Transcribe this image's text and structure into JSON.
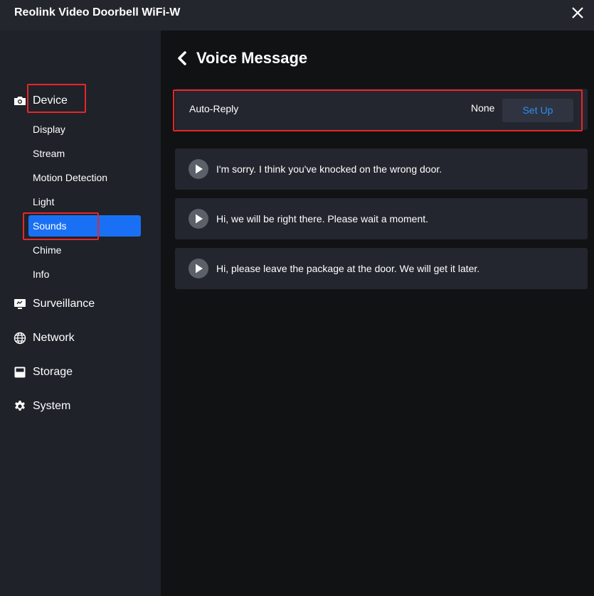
{
  "window": {
    "title": "Reolink Video Doorbell WiFi-W",
    "close_icon": "close-icon"
  },
  "sidebar": {
    "categories": [
      {
        "label": "Device",
        "icon": "camera-icon"
      },
      {
        "label": "Surveillance",
        "icon": "monitor-icon"
      },
      {
        "label": "Network",
        "icon": "globe-icon"
      },
      {
        "label": "Storage",
        "icon": "storage-icon"
      },
      {
        "label": "System",
        "icon": "gear-icon"
      }
    ],
    "device_items": [
      {
        "label": "Display"
      },
      {
        "label": "Stream"
      },
      {
        "label": "Motion Detection"
      },
      {
        "label": "Light"
      },
      {
        "label": "Sounds",
        "active": true
      },
      {
        "label": "Chime"
      },
      {
        "label": "Info"
      }
    ]
  },
  "main": {
    "title": "Voice Message",
    "auto_reply": {
      "label": "Auto-Reply",
      "value": "None",
      "button_label": "Set Up"
    },
    "messages": [
      {
        "text": "I'm sorry. I think you've knocked on the wrong door."
      },
      {
        "text": "Hi, we will be right there. Please wait a moment."
      },
      {
        "text": "Hi, please leave the package at the door. We will get it later."
      }
    ]
  },
  "colors": {
    "accent": "#1a70f4",
    "annotation": "#e8262a",
    "link": "#2b8ff5"
  }
}
